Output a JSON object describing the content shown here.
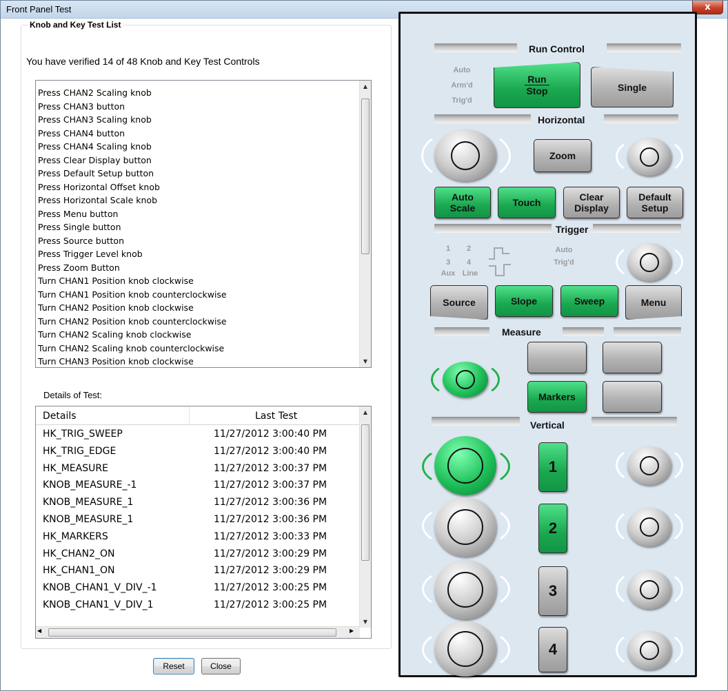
{
  "window": {
    "title": "Front Panel Test",
    "close_glyph": "x"
  },
  "group": {
    "legend": "Knob and Key Test List",
    "verified_text": "You have verified 14 of 48 Knob and Key Test Controls"
  },
  "test_list": [
    "Press CHAN2 Scaling knob",
    "Press CHAN3 button",
    "Press CHAN3 Scaling knob",
    "Press CHAN4 button",
    "Press CHAN4 Scaling knob",
    "Press Clear Display button",
    "Press Default Setup button",
    "Press Horizontal Offset knob",
    "Press Horizontal Scale knob",
    "Press Menu button",
    "Press Single button",
    "Press Source button",
    "Press Trigger Level knob",
    "Press Zoom Button",
    "Turn CHAN1 Position knob clockwise",
    "Turn CHAN1 Position knob counterclockwise",
    "Turn CHAN2 Position knob clockwise",
    "Turn CHAN2 Position knob counterclockwise",
    "Turn CHAN2 Scaling knob clockwise",
    "Turn CHAN2 Scaling knob counterclockwise",
    "Turn CHAN3 Position knob clockwise"
  ],
  "details": {
    "label": "Details of Test:",
    "columns": [
      "Details",
      "Last Test"
    ],
    "rows": [
      [
        "HK_TRIG_SWEEP",
        "11/27/2012 3:00:40 PM"
      ],
      [
        "HK_TRIG_EDGE",
        "11/27/2012 3:00:40 PM"
      ],
      [
        "HK_MEASURE",
        "11/27/2012 3:00:37 PM"
      ],
      [
        "KNOB_MEASURE_-1",
        "11/27/2012 3:00:37 PM"
      ],
      [
        "KNOB_MEASURE_1",
        "11/27/2012 3:00:36 PM"
      ],
      [
        "KNOB_MEASURE_1",
        "11/27/2012 3:00:36 PM"
      ],
      [
        "HK_MARKERS",
        "11/27/2012 3:00:33 PM"
      ],
      [
        "HK_CHAN2_ON",
        "11/27/2012 3:00:29 PM"
      ],
      [
        "HK_CHAN1_ON",
        "11/27/2012 3:00:29 PM"
      ],
      [
        "KNOB_CHAN1_V_DIV_-1",
        "11/27/2012 3:00:25 PM"
      ],
      [
        "KNOB_CHAN1_V_DIV_1",
        "11/27/2012 3:00:25 PM"
      ]
    ]
  },
  "buttons": {
    "reset": "Reset",
    "close": "Close"
  },
  "panel": {
    "run_control": {
      "title": "Run Control",
      "status": [
        "Auto",
        "Arm'd",
        "Trig'd"
      ],
      "run": "Run",
      "stop": "Stop",
      "single": "Single"
    },
    "horizontal": {
      "title": "Horizontal",
      "zoom": "Zoom",
      "auto_scale": [
        "Auto",
        "Scale"
      ],
      "touch": "Touch",
      "clear_display": [
        "Clear",
        "Display"
      ],
      "default_setup": [
        "Default",
        "Setup"
      ]
    },
    "trigger": {
      "title": "Trigger",
      "sources": [
        "1",
        "2",
        "3",
        "4",
        "Aux",
        "Line"
      ],
      "status": [
        "Auto",
        "Trig'd"
      ],
      "source": "Source",
      "slope": "Slope",
      "sweep": "Sweep",
      "menu": "Menu"
    },
    "measure": {
      "title": "Measure",
      "markers": "Markers"
    },
    "vertical": {
      "title": "Vertical",
      "channels": [
        "1",
        "2",
        "3",
        "4"
      ]
    }
  },
  "colors": {
    "active_green": "#1fc05a",
    "panel_bg": "#dde7f0"
  }
}
